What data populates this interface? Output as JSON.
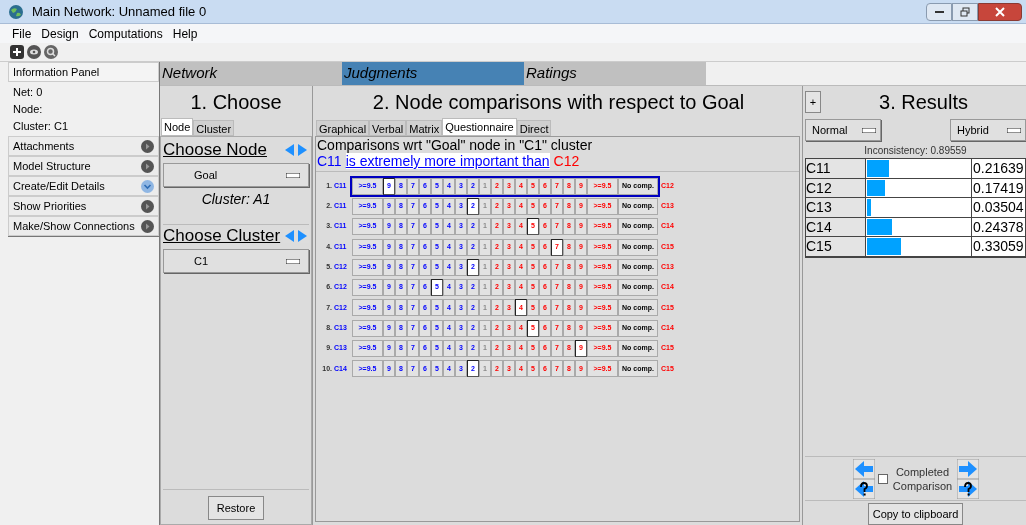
{
  "window": {
    "title": "Main Network: Unnamed file 0"
  },
  "menu": [
    "File",
    "Design",
    "Computations",
    "Help"
  ],
  "info_panel": {
    "title": "Information Panel",
    "lines": [
      "Net: 0",
      "Node:",
      "Cluster: C1"
    ],
    "items": [
      {
        "label": "Attachments",
        "expanded": false
      },
      {
        "label": "Model Structure",
        "expanded": false
      },
      {
        "label": "Create/Edit Details",
        "expanded": true
      },
      {
        "label": "Show Priorities",
        "expanded": false
      },
      {
        "label": "Make/Show Connections",
        "expanded": false
      }
    ]
  },
  "mode_tabs": [
    {
      "label": "Network",
      "selected": false
    },
    {
      "label": "Judgments",
      "selected": true
    },
    {
      "label": "Ratings",
      "selected": false
    }
  ],
  "choose": {
    "title": "1. Choose",
    "tabs": [
      {
        "label": "Node",
        "selected": true
      },
      {
        "label": "Cluster",
        "selected": false
      }
    ],
    "node_heading": "Choose Node",
    "node_value": "Goal",
    "cluster_caption": "Cluster: A1",
    "cluster_heading": "Choose Cluster",
    "cluster_value": "C1",
    "restore": "Restore"
  },
  "comparisons": {
    "title": "2. Node comparisons with respect to Goal",
    "tabs": [
      {
        "label": "Graphical",
        "selected": false
      },
      {
        "label": "Verbal",
        "selected": false
      },
      {
        "label": "Matrix",
        "selected": false
      },
      {
        "label": "Questionnaire",
        "selected": true
      },
      {
        "label": "Direct",
        "selected": false
      }
    ],
    "heading": "Comparisons wrt \"Goal\" node in \"C1\" cluster",
    "verbal": {
      "left_node": "C11",
      "phrase": "is extremely more important than",
      "right_node": "C12"
    },
    "rows": [
      {
        "number": "1.",
        "left": "C11",
        "right": "C12",
        "focused": true,
        "buttons": [
          {
            "label": ">=9.5",
            "kind": "left",
            "selected": false
          },
          {
            "label": "9",
            "kind": "left",
            "selected": true
          },
          {
            "label": "8",
            "kind": "left",
            "selected": false
          },
          {
            "label": "7",
            "kind": "left",
            "selected": false
          },
          {
            "label": "6",
            "kind": "left",
            "selected": false
          },
          {
            "label": "5",
            "kind": "left",
            "selected": false
          },
          {
            "label": "4",
            "kind": "left",
            "selected": false
          },
          {
            "label": "3",
            "kind": "left",
            "selected": false
          },
          {
            "label": "2",
            "kind": "left",
            "selected": false
          },
          {
            "label": "1",
            "kind": "equal",
            "selected": false
          },
          {
            "label": "2",
            "kind": "right",
            "selected": false
          },
          {
            "label": "3",
            "kind": "right",
            "selected": false
          },
          {
            "label": "4",
            "kind": "right",
            "selected": false
          },
          {
            "label": "5",
            "kind": "right",
            "selected": false
          },
          {
            "label": "6",
            "kind": "right",
            "selected": false
          },
          {
            "label": "7",
            "kind": "right",
            "selected": false
          },
          {
            "label": "8",
            "kind": "right",
            "selected": false
          },
          {
            "label": "9",
            "kind": "right",
            "selected": false
          },
          {
            "label": ">=9.5",
            "kind": "right",
            "selected": false
          },
          {
            "label": "No comp.",
            "kind": "none",
            "selected": false
          }
        ]
      },
      {
        "number": "2.",
        "left": "C11",
        "right": "C13",
        "focused": false,
        "buttons": [
          {
            "label": ">=9.5",
            "kind": "left",
            "selected": false
          },
          {
            "label": "9",
            "kind": "left",
            "selected": false
          },
          {
            "label": "8",
            "kind": "left",
            "selected": false
          },
          {
            "label": "7",
            "kind": "left",
            "selected": false
          },
          {
            "label": "6",
            "kind": "left",
            "selected": false
          },
          {
            "label": "5",
            "kind": "left",
            "selected": false
          },
          {
            "label": "4",
            "kind": "left",
            "selected": false
          },
          {
            "label": "3",
            "kind": "left",
            "selected": false
          },
          {
            "label": "2",
            "kind": "left",
            "selected": true
          },
          {
            "label": "1",
            "kind": "equal",
            "selected": false
          },
          {
            "label": "2",
            "kind": "right",
            "selected": false
          },
          {
            "label": "3",
            "kind": "right",
            "selected": false
          },
          {
            "label": "4",
            "kind": "right",
            "selected": false
          },
          {
            "label": "5",
            "kind": "right",
            "selected": false
          },
          {
            "label": "6",
            "kind": "right",
            "selected": false
          },
          {
            "label": "7",
            "kind": "right",
            "selected": false
          },
          {
            "label": "8",
            "kind": "right",
            "selected": false
          },
          {
            "label": "9",
            "kind": "right",
            "selected": false
          },
          {
            "label": ">=9.5",
            "kind": "right",
            "selected": false
          },
          {
            "label": "No comp.",
            "kind": "none",
            "selected": false
          }
        ]
      },
      {
        "number": "3.",
        "left": "C11",
        "right": "C14",
        "focused": false,
        "buttons": [
          {
            "label": ">=9.5",
            "kind": "left",
            "selected": false
          },
          {
            "label": "9",
            "kind": "left",
            "selected": false
          },
          {
            "label": "8",
            "kind": "left",
            "selected": false
          },
          {
            "label": "7",
            "kind": "left",
            "selected": false
          },
          {
            "label": "6",
            "kind": "left",
            "selected": false
          },
          {
            "label": "5",
            "kind": "left",
            "selected": false
          },
          {
            "label": "4",
            "kind": "left",
            "selected": false
          },
          {
            "label": "3",
            "kind": "left",
            "selected": false
          },
          {
            "label": "2",
            "kind": "left",
            "selected": false
          },
          {
            "label": "1",
            "kind": "equal",
            "selected": false
          },
          {
            "label": "2",
            "kind": "right",
            "selected": false
          },
          {
            "label": "3",
            "kind": "right",
            "selected": false
          },
          {
            "label": "4",
            "kind": "right",
            "selected": false
          },
          {
            "label": "5",
            "kind": "right",
            "selected": true
          },
          {
            "label": "6",
            "kind": "right",
            "selected": false
          },
          {
            "label": "7",
            "kind": "right",
            "selected": false
          },
          {
            "label": "8",
            "kind": "right",
            "selected": false
          },
          {
            "label": "9",
            "kind": "right",
            "selected": false
          },
          {
            "label": ">=9.5",
            "kind": "right",
            "selected": false
          },
          {
            "label": "No comp.",
            "kind": "none",
            "selected": false
          }
        ]
      },
      {
        "number": "4.",
        "left": "C11",
        "right": "C15",
        "focused": false,
        "buttons": [
          {
            "label": ">=9.5",
            "kind": "left",
            "selected": false
          },
          {
            "label": "9",
            "kind": "left",
            "selected": false
          },
          {
            "label": "8",
            "kind": "left",
            "selected": false
          },
          {
            "label": "7",
            "kind": "left",
            "selected": false
          },
          {
            "label": "6",
            "kind": "left",
            "selected": false
          },
          {
            "label": "5",
            "kind": "left",
            "selected": false
          },
          {
            "label": "4",
            "kind": "left",
            "selected": false
          },
          {
            "label": "3",
            "kind": "left",
            "selected": false
          },
          {
            "label": "2",
            "kind": "left",
            "selected": false
          },
          {
            "label": "1",
            "kind": "equal",
            "selected": false
          },
          {
            "label": "2",
            "kind": "right",
            "selected": false
          },
          {
            "label": "3",
            "kind": "right",
            "selected": false
          },
          {
            "label": "4",
            "kind": "right",
            "selected": false
          },
          {
            "label": "5",
            "kind": "right",
            "selected": false
          },
          {
            "label": "6",
            "kind": "right",
            "selected": false
          },
          {
            "label": "7",
            "kind": "right",
            "selected": true
          },
          {
            "label": "8",
            "kind": "right",
            "selected": false
          },
          {
            "label": "9",
            "kind": "right",
            "selected": false
          },
          {
            "label": ">=9.5",
            "kind": "right",
            "selected": false
          },
          {
            "label": "No comp.",
            "kind": "none",
            "selected": false
          }
        ]
      },
      {
        "number": "5.",
        "left": "C12",
        "right": "C13",
        "focused": false,
        "buttons": [
          {
            "label": ">=9.5",
            "kind": "left",
            "selected": false
          },
          {
            "label": "9",
            "kind": "left",
            "selected": false
          },
          {
            "label": "8",
            "kind": "left",
            "selected": false
          },
          {
            "label": "7",
            "kind": "left",
            "selected": false
          },
          {
            "label": "6",
            "kind": "left",
            "selected": false
          },
          {
            "label": "5",
            "kind": "left",
            "selected": false
          },
          {
            "label": "4",
            "kind": "left",
            "selected": false
          },
          {
            "label": "3",
            "kind": "left",
            "selected": false
          },
          {
            "label": "2",
            "kind": "left",
            "selected": true
          },
          {
            "label": "1",
            "kind": "equal",
            "selected": false
          },
          {
            "label": "2",
            "kind": "right",
            "selected": false
          },
          {
            "label": "3",
            "kind": "right",
            "selected": false
          },
          {
            "label": "4",
            "kind": "right",
            "selected": false
          },
          {
            "label": "5",
            "kind": "right",
            "selected": false
          },
          {
            "label": "6",
            "kind": "right",
            "selected": false
          },
          {
            "label": "7",
            "kind": "right",
            "selected": false
          },
          {
            "label": "8",
            "kind": "right",
            "selected": false
          },
          {
            "label": "9",
            "kind": "right",
            "selected": false
          },
          {
            "label": ">=9.5",
            "kind": "right",
            "selected": false
          },
          {
            "label": "No comp.",
            "kind": "none",
            "selected": false
          }
        ]
      },
      {
        "number": "6.",
        "left": "C12",
        "right": "C14",
        "focused": false,
        "buttons": [
          {
            "label": ">=9.5",
            "kind": "left",
            "selected": false
          },
          {
            "label": "9",
            "kind": "left",
            "selected": false
          },
          {
            "label": "8",
            "kind": "left",
            "selected": false
          },
          {
            "label": "7",
            "kind": "left",
            "selected": false
          },
          {
            "label": "6",
            "kind": "left",
            "selected": false
          },
          {
            "label": "5",
            "kind": "left",
            "selected": true
          },
          {
            "label": "4",
            "kind": "left",
            "selected": false
          },
          {
            "label": "3",
            "kind": "left",
            "selected": false
          },
          {
            "label": "2",
            "kind": "left",
            "selected": false
          },
          {
            "label": "1",
            "kind": "equal",
            "selected": false
          },
          {
            "label": "2",
            "kind": "right",
            "selected": false
          },
          {
            "label": "3",
            "kind": "right",
            "selected": false
          },
          {
            "label": "4",
            "kind": "right",
            "selected": false
          },
          {
            "label": "5",
            "kind": "right",
            "selected": false
          },
          {
            "label": "6",
            "kind": "right",
            "selected": false
          },
          {
            "label": "7",
            "kind": "right",
            "selected": false
          },
          {
            "label": "8",
            "kind": "right",
            "selected": false
          },
          {
            "label": "9",
            "kind": "right",
            "selected": false
          },
          {
            "label": ">=9.5",
            "kind": "right",
            "selected": false
          },
          {
            "label": "No comp.",
            "kind": "none",
            "selected": false
          }
        ]
      },
      {
        "number": "7.",
        "left": "C12",
        "right": "C15",
        "focused": false,
        "buttons": [
          {
            "label": ">=9.5",
            "kind": "left",
            "selected": false
          },
          {
            "label": "9",
            "kind": "left",
            "selected": false
          },
          {
            "label": "8",
            "kind": "left",
            "selected": false
          },
          {
            "label": "7",
            "kind": "left",
            "selected": false
          },
          {
            "label": "6",
            "kind": "left",
            "selected": false
          },
          {
            "label": "5",
            "kind": "left",
            "selected": false
          },
          {
            "label": "4",
            "kind": "left",
            "selected": false
          },
          {
            "label": "3",
            "kind": "left",
            "selected": false
          },
          {
            "label": "2",
            "kind": "left",
            "selected": false
          },
          {
            "label": "1",
            "kind": "equal",
            "selected": false
          },
          {
            "label": "2",
            "kind": "right",
            "selected": false
          },
          {
            "label": "3",
            "kind": "right",
            "selected": false
          },
          {
            "label": "4",
            "kind": "right",
            "selected": true
          },
          {
            "label": "5",
            "kind": "right",
            "selected": false
          },
          {
            "label": "6",
            "kind": "right",
            "selected": false
          },
          {
            "label": "7",
            "kind": "right",
            "selected": false
          },
          {
            "label": "8",
            "kind": "right",
            "selected": false
          },
          {
            "label": "9",
            "kind": "right",
            "selected": false
          },
          {
            "label": ">=9.5",
            "kind": "right",
            "selected": false
          },
          {
            "label": "No comp.",
            "kind": "none",
            "selected": false
          }
        ]
      },
      {
        "number": "8.",
        "left": "C13",
        "right": "C14",
        "focused": false,
        "buttons": [
          {
            "label": ">=9.5",
            "kind": "left",
            "selected": false
          },
          {
            "label": "9",
            "kind": "left",
            "selected": false
          },
          {
            "label": "8",
            "kind": "left",
            "selected": false
          },
          {
            "label": "7",
            "kind": "left",
            "selected": false
          },
          {
            "label": "6",
            "kind": "left",
            "selected": false
          },
          {
            "label": "5",
            "kind": "left",
            "selected": false
          },
          {
            "label": "4",
            "kind": "left",
            "selected": false
          },
          {
            "label": "3",
            "kind": "left",
            "selected": false
          },
          {
            "label": "2",
            "kind": "left",
            "selected": false
          },
          {
            "label": "1",
            "kind": "equal",
            "selected": false
          },
          {
            "label": "2",
            "kind": "right",
            "selected": false
          },
          {
            "label": "3",
            "kind": "right",
            "selected": false
          },
          {
            "label": "4",
            "kind": "right",
            "selected": false
          },
          {
            "label": "5",
            "kind": "right",
            "selected": true
          },
          {
            "label": "6",
            "kind": "right",
            "selected": false
          },
          {
            "label": "7",
            "kind": "right",
            "selected": false
          },
          {
            "label": "8",
            "kind": "right",
            "selected": false
          },
          {
            "label": "9",
            "kind": "right",
            "selected": false
          },
          {
            "label": ">=9.5",
            "kind": "right",
            "selected": false
          },
          {
            "label": "No comp.",
            "kind": "none",
            "selected": false
          }
        ]
      },
      {
        "number": "9.",
        "left": "C13",
        "right": "C15",
        "focused": false,
        "buttons": [
          {
            "label": ">=9.5",
            "kind": "left",
            "selected": false
          },
          {
            "label": "9",
            "kind": "left",
            "selected": false
          },
          {
            "label": "8",
            "kind": "left",
            "selected": false
          },
          {
            "label": "7",
            "kind": "left",
            "selected": false
          },
          {
            "label": "6",
            "kind": "left",
            "selected": false
          },
          {
            "label": "5",
            "kind": "left",
            "selected": false
          },
          {
            "label": "4",
            "kind": "left",
            "selected": false
          },
          {
            "label": "3",
            "kind": "left",
            "selected": false
          },
          {
            "label": "2",
            "kind": "left",
            "selected": false
          },
          {
            "label": "1",
            "kind": "equal",
            "selected": false
          },
          {
            "label": "2",
            "kind": "right",
            "selected": false
          },
          {
            "label": "3",
            "kind": "right",
            "selected": false
          },
          {
            "label": "4",
            "kind": "right",
            "selected": false
          },
          {
            "label": "5",
            "kind": "right",
            "selected": false
          },
          {
            "label": "6",
            "kind": "right",
            "selected": false
          },
          {
            "label": "7",
            "kind": "right",
            "selected": false
          },
          {
            "label": "8",
            "kind": "right",
            "selected": false
          },
          {
            "label": "9",
            "kind": "right",
            "selected": true
          },
          {
            "label": ">=9.5",
            "kind": "right",
            "selected": false
          },
          {
            "label": "No comp.",
            "kind": "none",
            "selected": false
          }
        ]
      },
      {
        "number": "10.",
        "left": "C14",
        "right": "C15",
        "focused": false,
        "buttons": [
          {
            "label": ">=9.5",
            "kind": "left",
            "selected": false
          },
          {
            "label": "9",
            "kind": "left",
            "selected": false
          },
          {
            "label": "8",
            "kind": "left",
            "selected": false
          },
          {
            "label": "7",
            "kind": "left",
            "selected": false
          },
          {
            "label": "6",
            "kind": "left",
            "selected": false
          },
          {
            "label": "5",
            "kind": "left",
            "selected": false
          },
          {
            "label": "4",
            "kind": "left",
            "selected": false
          },
          {
            "label": "3",
            "kind": "left",
            "selected": false
          },
          {
            "label": "2",
            "kind": "left",
            "selected": true
          },
          {
            "label": "1",
            "kind": "equal",
            "selected": false
          },
          {
            "label": "2",
            "kind": "right",
            "selected": false
          },
          {
            "label": "3",
            "kind": "right",
            "selected": false
          },
          {
            "label": "4",
            "kind": "right",
            "selected": false
          },
          {
            "label": "5",
            "kind": "right",
            "selected": false
          },
          {
            "label": "6",
            "kind": "right",
            "selected": false
          },
          {
            "label": "7",
            "kind": "right",
            "selected": false
          },
          {
            "label": "8",
            "kind": "right",
            "selected": false
          },
          {
            "label": "9",
            "kind": "right",
            "selected": false
          },
          {
            "label": ">=9.5",
            "kind": "right",
            "selected": false
          },
          {
            "label": "No comp.",
            "kind": "none",
            "selected": false
          }
        ]
      }
    ]
  },
  "results": {
    "title": "3. Results",
    "plus": "+",
    "mode": "Normal",
    "method": "Hybrid",
    "inconsistency": "Inconsistency: 0.89559",
    "rows": [
      {
        "name": "C11",
        "level": 0.21639,
        "value": "0.21639"
      },
      {
        "name": "C12",
        "level": 0.17419,
        "value": "0.17419"
      },
      {
        "name": "C13",
        "level": 0.03504,
        "value": "0.03504"
      },
      {
        "name": "C14",
        "level": 0.24378,
        "value": "0.24378"
      },
      {
        "name": "C15",
        "level": 0.33059,
        "value": "0.33059"
      }
    ],
    "completed": {
      "label": "Completed Comparison",
      "checked": false
    },
    "copy": "Copy to clipboard"
  }
}
